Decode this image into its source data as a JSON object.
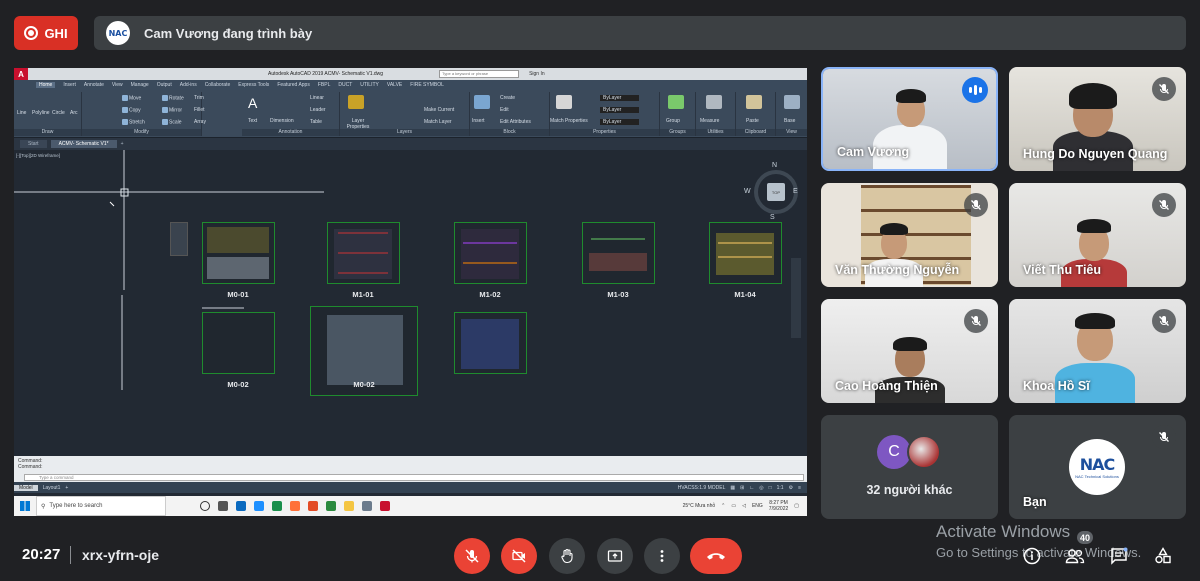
{
  "record_button": {
    "label": "GHI"
  },
  "presenter": {
    "logo_text": "NAC",
    "text": "Cam Vương đang trình bày"
  },
  "cad": {
    "title": "Autodesk AutoCAD 2019   ACMV- Schematic V1.dwg",
    "search_placeholder": "Type a keyword or phrase",
    "signin": "Sign In",
    "ribbon_tabs": [
      "Home",
      "Insert",
      "Annotate",
      "View",
      "Manage",
      "Output",
      "Add-ins",
      "Collaborate",
      "Express Tools",
      "Featured Apps",
      "FBPL",
      "DUCT",
      "UTILITY",
      "VALVE",
      "FIRE SYMBOL"
    ],
    "groups": [
      "Draw",
      "Modify",
      "Annotation",
      "Layers",
      "Block",
      "Properties",
      "Groups",
      "Utilities",
      "Clipboard",
      "View"
    ],
    "draw_tools": [
      "Line",
      "Polyline",
      "Circle",
      "Arc"
    ],
    "modify_tools": [
      "Move",
      "Rotate",
      "Trim",
      "Copy",
      "Mirror",
      "Fillet",
      "Stretch",
      "Scale",
      "Array"
    ],
    "annotation_tools": [
      "Text",
      "Dimension",
      "Linear",
      "Leader",
      "Table"
    ],
    "layer_tools": [
      "Layer Properties",
      "Make Current",
      "Match Layer"
    ],
    "block_tools": [
      "Insert",
      "Create",
      "Edit",
      "Edit Attributes"
    ],
    "props": [
      "ByLayer",
      "ByLayer",
      "ByLayer"
    ],
    "match_props": "Match Properties",
    "group_btn": "Group",
    "measure_btn": "Measure",
    "paste_btn": "Paste",
    "base_btn": "Base",
    "doc_tabs": [
      "Start",
      "ACMV- Schematic V1*"
    ],
    "viewport_label": "[-][Top][2D Wireframe]",
    "compass": {
      "n": "N",
      "s": "S",
      "e": "E",
      "w": "W",
      "top": "TOP"
    },
    "sheet_labels": [
      "M0-01",
      "M1-01",
      "M1-02",
      "M1-03",
      "M1-04",
      "M0-02",
      "M0-02"
    ],
    "command_lines": [
      "Command:",
      "Command:"
    ],
    "command_placeholder": "Type a command",
    "layout_tabs": [
      "Model",
      "Layout1"
    ],
    "status_text": "HVACSS:1.9  MODEL",
    "status_scale": "1:1"
  },
  "taskbar": {
    "search_placeholder": "Type here to search",
    "weather": "25°C  Mưa nhỏ",
    "lang": "ENG",
    "time": "8:27 PM",
    "date": "7/9/2022"
  },
  "tiles": [
    {
      "name": "Cam Vương",
      "state": "speaking"
    },
    {
      "name": "Hung Do Nguyen Quang",
      "state": "muted"
    },
    {
      "name": "Văn Thường Nguyễn",
      "state": "muted"
    },
    {
      "name": "Viết Thu Tiêu",
      "state": "muted"
    },
    {
      "name": "Cao Hoàng Thiện",
      "state": "muted"
    },
    {
      "name": "Khoa Hồ Sĩ",
      "state": "muted"
    }
  ],
  "others": {
    "avatar_letter": "C",
    "text": "32 người khác"
  },
  "self": {
    "name": "Bạn",
    "logo_main": "NAC",
    "logo_sub": "NAC Technical Solutions"
  },
  "meeting": {
    "time": "20:27",
    "code": "xrx-yfrn-oje"
  },
  "activation": {
    "title": "Activate Windows",
    "sub": "Go to Settings to activate Windows."
  },
  "participant_count": "40",
  "colors": {
    "record": "#d93025",
    "end_call": "#ea4335",
    "speaking": "#1a73e8",
    "tile_bg": "#3c4043",
    "page_bg": "#202124"
  }
}
